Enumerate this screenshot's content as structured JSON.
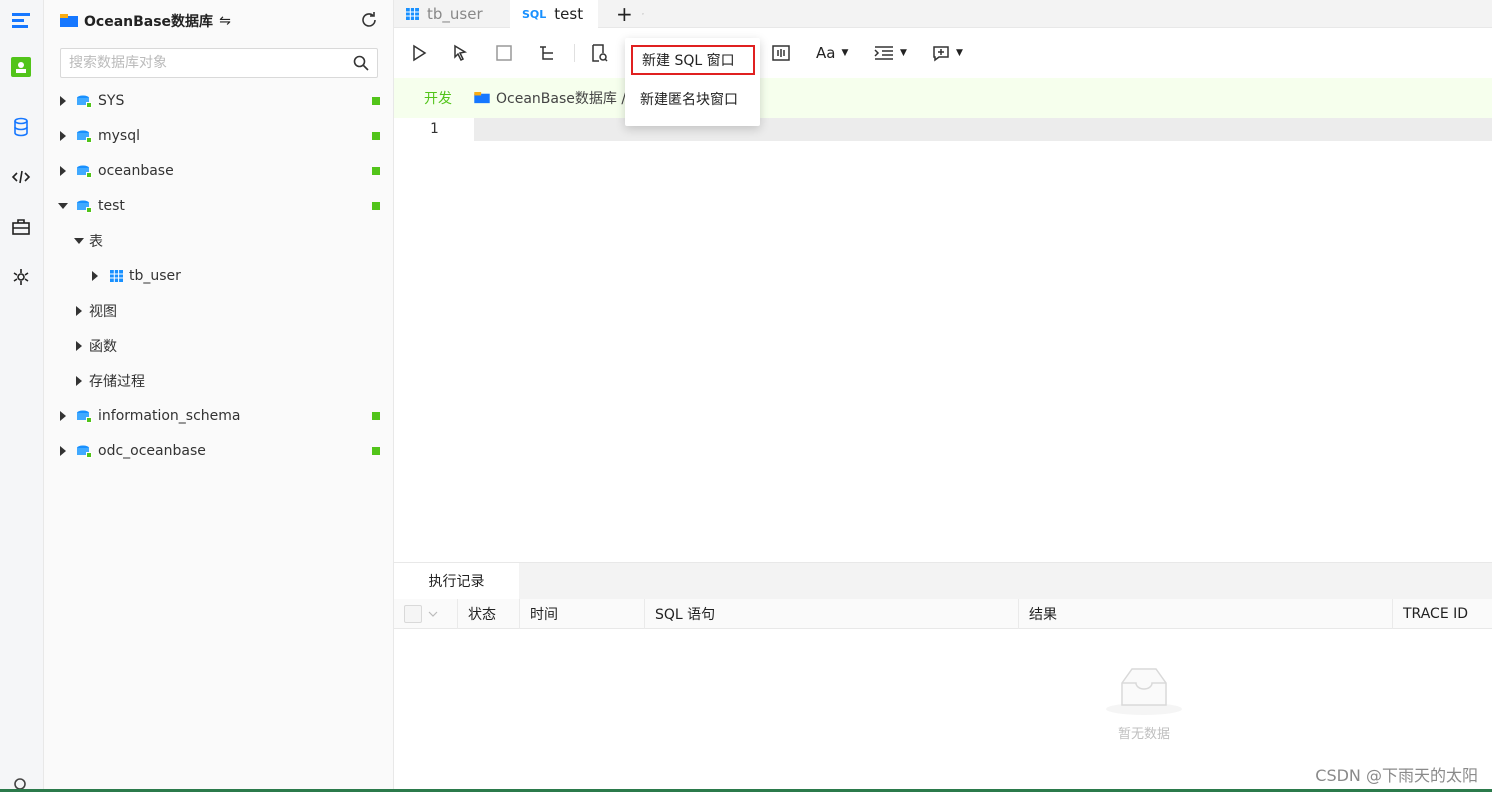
{
  "sidebar": {
    "db_name": "OceanBase数据库",
    "search_placeholder": "搜索数据库对象",
    "tree": [
      {
        "label": "SYS"
      },
      {
        "label": "mysql"
      },
      {
        "label": "oceanbase"
      },
      {
        "label": "test"
      },
      {
        "label": "表"
      },
      {
        "label": "tb_user"
      },
      {
        "label": "视图"
      },
      {
        "label": "函数"
      },
      {
        "label": "存储过程"
      },
      {
        "label": "information_schema"
      },
      {
        "label": "odc_oceanbase"
      }
    ]
  },
  "tabs": [
    {
      "label": "tb_user"
    },
    {
      "label": "test",
      "prefix": "SQL"
    }
  ],
  "breadcrumb": {
    "env": "开发",
    "db": "OceanBase数据库 /"
  },
  "toolbar": {
    "font_label": "Aa"
  },
  "dropdown": {
    "items": [
      {
        "label": "新建 SQL 窗口"
      },
      {
        "label": "新建匿名块窗口"
      }
    ]
  },
  "editor": {
    "line_number": "1"
  },
  "result": {
    "tab_label": "执行记录",
    "columns": [
      "状态",
      "时间",
      "SQL 语句",
      "结果",
      "TRACE ID"
    ],
    "empty_text": "暂无数据"
  },
  "watermark": "CSDN @下雨天的太阳",
  "colors": {
    "accent": "#1890ff",
    "status_green": "#52c41a",
    "env_green": "#52c41a",
    "highlight_red": "#e02020"
  }
}
